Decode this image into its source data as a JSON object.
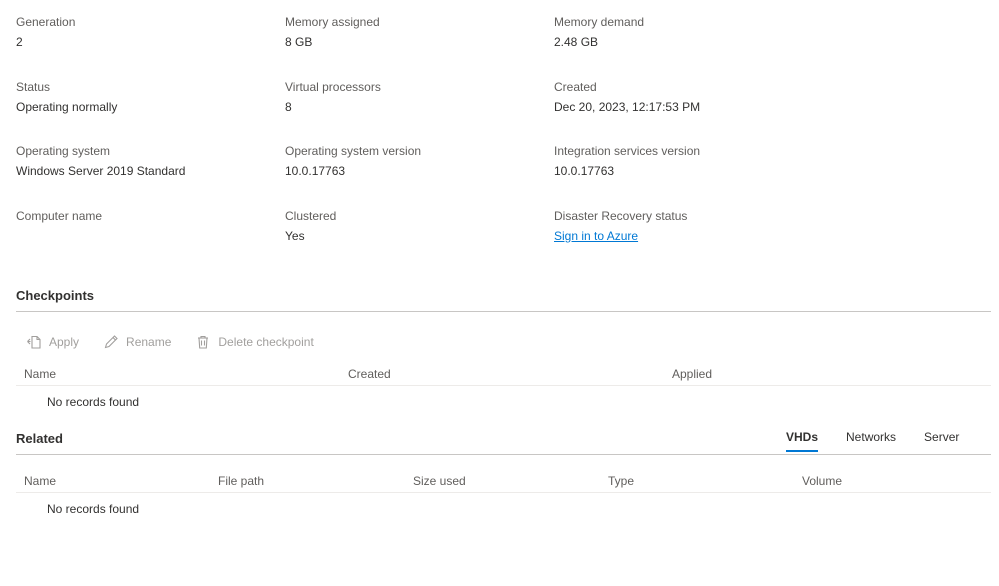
{
  "properties": [
    {
      "label": "Generation",
      "value": "2"
    },
    {
      "label": "Memory assigned",
      "value": "8 GB"
    },
    {
      "label": "Memory demand",
      "value": "2.48 GB"
    },
    {
      "label": "Status",
      "value": "Operating normally"
    },
    {
      "label": "Virtual processors",
      "value": "8"
    },
    {
      "label": "Created",
      "value": "Dec 20, 2023, 12:17:53 PM"
    },
    {
      "label": "Operating system",
      "value": "Windows Server 2019 Standard"
    },
    {
      "label": "Operating system version",
      "value": "10.0.17763"
    },
    {
      "label": "Integration services version",
      "value": "10.0.17763"
    },
    {
      "label": "Computer name",
      "value": ""
    },
    {
      "label": "Clustered",
      "value": "Yes"
    },
    {
      "label": "Disaster Recovery status",
      "value": "Sign in to Azure"
    }
  ],
  "checkpoints": {
    "title": "Checkpoints",
    "toolbar": {
      "apply_label": "Apply",
      "rename_label": "Rename",
      "delete_label": "Delete checkpoint"
    },
    "columns": [
      "Name",
      "Created",
      "Applied"
    ],
    "empty_text": "No records found"
  },
  "related": {
    "title": "Related",
    "tabs": [
      "VHDs",
      "Networks",
      "Server"
    ],
    "active_tab": "VHDs",
    "columns": [
      "Name",
      "File path",
      "Size used",
      "Type",
      "Volume"
    ],
    "empty_text": "No records found"
  },
  "colors": {
    "link": "#0078d4",
    "disabled": "#a19f9d",
    "divider": "#c8c6c4"
  }
}
